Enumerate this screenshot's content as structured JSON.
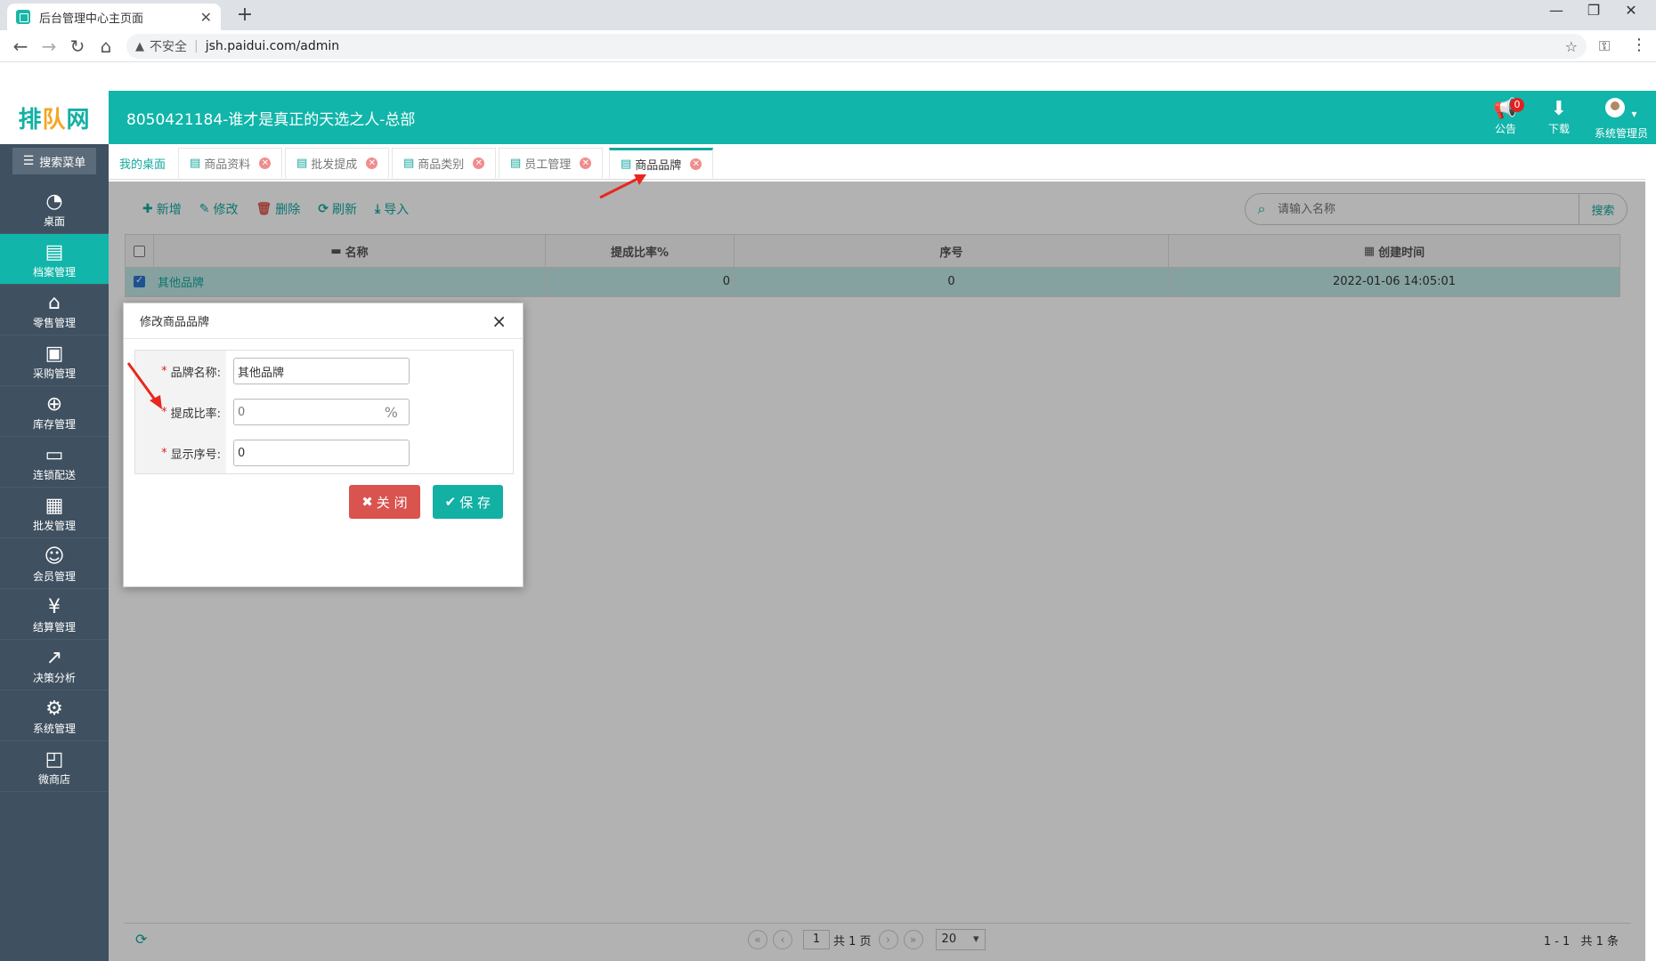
{
  "browser": {
    "tab_title": "后台管理中心主页面",
    "tab_close": "✕",
    "new_tab": "+",
    "security": "不安全",
    "url": "jsh.paidui.com/admin",
    "window": {
      "minimize": "—",
      "restore": "❐",
      "close": "✕"
    }
  },
  "header": {
    "logo_a": "排",
    "logo_b": "队",
    "logo_c": "网",
    "company": "8050421184-谁才是真正的天选之人-总部",
    "notice_label": "公告",
    "notice_badge": "0",
    "download_label": "下载",
    "user_label": "系统管理员"
  },
  "sidebar": {
    "search_label": "搜索菜单",
    "items": [
      {
        "label": "桌面",
        "icon": "dashboard-icon"
      },
      {
        "label": "档案管理",
        "icon": "file-icon"
      },
      {
        "label": "零售管理",
        "icon": "store-icon"
      },
      {
        "label": "采购管理",
        "icon": "cart-icon"
      },
      {
        "label": "库存管理",
        "icon": "inventory-icon"
      },
      {
        "label": "连锁配送",
        "icon": "truck-icon"
      },
      {
        "label": "批发管理",
        "icon": "wholesale-icon"
      },
      {
        "label": "会员管理",
        "icon": "member-icon"
      },
      {
        "label": "结算管理",
        "icon": "settle-icon"
      },
      {
        "label": "决策分析",
        "icon": "analysis-icon"
      },
      {
        "label": "系统管理",
        "icon": "gear-icon"
      },
      {
        "label": "微商店",
        "icon": "shop-icon"
      }
    ]
  },
  "tabs": {
    "home": "我的桌面",
    "items": [
      "商品资料",
      "批发提成",
      "商品类别",
      "员工管理",
      "商品品牌"
    ]
  },
  "toolbar": {
    "add": "新增",
    "edit": "修改",
    "delete": "删除",
    "refresh": "刷新",
    "import": "导入",
    "search_placeholder": "请输入名称",
    "search_button": "搜索"
  },
  "grid": {
    "headers": {
      "name": "名称",
      "rate": "提成比率%",
      "seq": "序号",
      "time": "创建时间"
    },
    "rows": [
      {
        "name": "其他品牌",
        "rate": "0",
        "seq": "0",
        "time": "2022-01-06 14:05:01"
      }
    ]
  },
  "pager": {
    "page": "1",
    "total_pages": "共 1 页",
    "page_size": "20",
    "range": "1 - 1",
    "total": "共 1 条"
  },
  "modal": {
    "title": "修改商品品牌",
    "fields": [
      {
        "label": "品牌名称:",
        "value": "其他品牌"
      },
      {
        "label": "提成比率:",
        "value": "0",
        "suffix": "%"
      },
      {
        "label": "显示序号:",
        "value": "0"
      }
    ],
    "close_button": "关 闭",
    "save_button": "保 存"
  },
  "colors": {
    "accent": "#11b5a9",
    "sidebar": "#3f5060",
    "danger": "#d9534f"
  }
}
